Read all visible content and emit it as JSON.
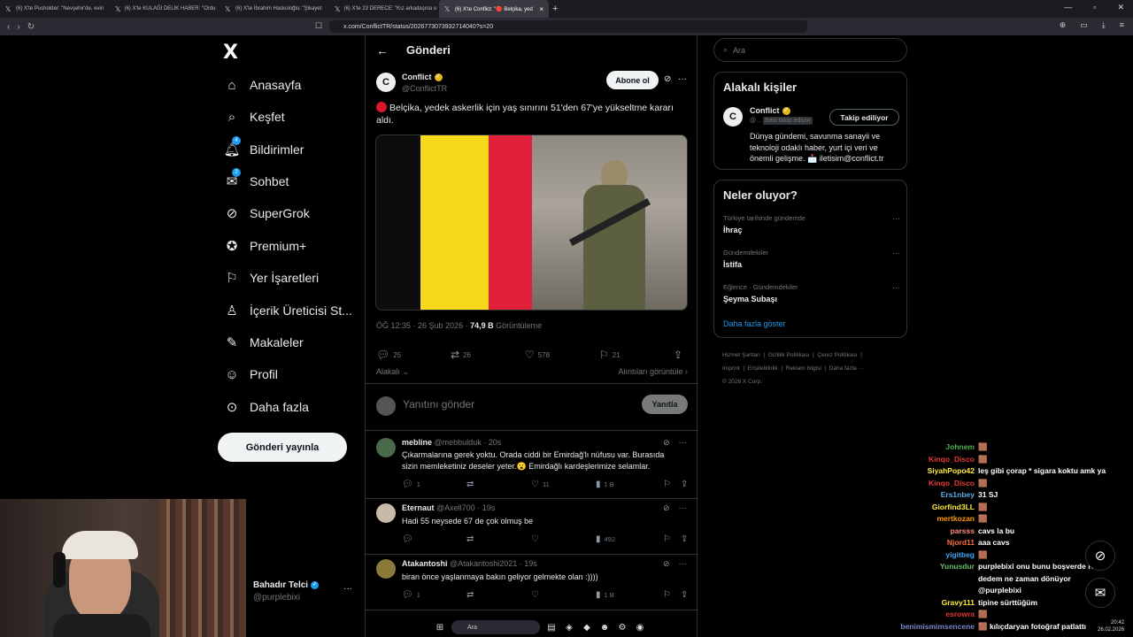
{
  "browser": {
    "tabs": [
      {
        "label": "(6) X'te Pusholder: \"Nevşehir'de, evin",
        "active": false
      },
      {
        "label": "(6) X'te KULAĞI DELİK HABER: \"Ordu",
        "active": false
      },
      {
        "label": "(6) X'te İbrahim Haskoloğlu: \"Şikayet",
        "active": false
      },
      {
        "label": "(6) X'te 23 DERECE: \"Kız arkadaşına o",
        "active": false
      },
      {
        "label": "(6) X'te Conflict: \"🔴 Belçika, yed",
        "active": true
      }
    ],
    "new_tab": "+",
    "url": "x.com/ConflictTR/status/2026773073932714040?s=20"
  },
  "sidebar": {
    "logo": "X",
    "items": [
      {
        "label": "Anasayfa",
        "icon": "home-icon"
      },
      {
        "label": "Keşfet",
        "icon": "search-icon"
      },
      {
        "label": "Bildirimler",
        "icon": "bell-icon",
        "badge": "4"
      },
      {
        "label": "Sohbet",
        "icon": "mail-icon",
        "badge": "2"
      },
      {
        "label": "SuperGrok",
        "icon": "grok-icon"
      },
      {
        "label": "Premium+",
        "icon": "verified-icon"
      },
      {
        "label": "Yer İşaretleri",
        "icon": "bookmark-icon"
      },
      {
        "label": "İçerik Üreticisi St...",
        "icon": "creator-icon"
      },
      {
        "label": "Makaleler",
        "icon": "article-icon"
      },
      {
        "label": "Profil",
        "icon": "person-icon"
      },
      {
        "label": "Daha fazla",
        "icon": "more-circle-icon"
      }
    ],
    "post_button": "Gönderi yayınla",
    "profile": {
      "name": "Bahadır Telci",
      "handle": "@purplebixi",
      "more": "···"
    }
  },
  "main": {
    "title": "Gönderi",
    "post": {
      "author": "Conflict",
      "handle": "@ConflictTR",
      "avatar_letter": "C",
      "subscribe": "Abone ol",
      "text": "Belçika, yedek askerlik için yaş sınırını 51'den 67'ye yükseltme kararı aldı.",
      "time": "ÖĞ 12:35 · 26 Şub 2026 · ",
      "views": "74,9 B",
      "views_label": " Görüntüleme",
      "replies": "25",
      "reposts": "26",
      "likes": "578",
      "bookmarks": "21",
      "sort": "Alakalı",
      "quotes": "Alıntıları görüntüle"
    },
    "reply_box": {
      "placeholder": "Yanıtını gönder",
      "button": "Yanıtla"
    },
    "replies": [
      {
        "name": "mebline",
        "meta": "@mebbulduk · 20s",
        "text": "Çıkarmalarına gerek yoktu. Orada ciddi bir Emirdağ'lı nüfusu var. Burasıda sizin memleketiniz deseler yeter.😮 Emirdağlı kardeşlerimize selamlar.",
        "replies": "1",
        "reposts": "",
        "likes": "11",
        "views": "1 B"
      },
      {
        "name": "Eternaut",
        "meta": "@Axell700 · 19s",
        "text": "Hadi 55 neysede 67 de çok olmuş be",
        "replies": "",
        "reposts": "",
        "likes": "",
        "views": "492"
      },
      {
        "name": "Atakantoshi",
        "meta": "@Atakantoshi2021 · 19s",
        "text": "biran önce yaşlanmaya bakın geliyor gelmekte olan :))))",
        "replies": "1",
        "reposts": "",
        "likes": "",
        "views": "1 B"
      }
    ]
  },
  "right": {
    "search_placeholder": "Ara",
    "relevant": {
      "title": "Alakalı kişiler",
      "name": "Conflict",
      "handle": "@...",
      "follows_you": "Seni takip ediyor",
      "button": "Takip ediliyor",
      "bio": "Dünya gündemi, savunma sanayii ve teknoloji odaklı haber, yurt içi veri ve önemli gelişme. 📩 iletisim@conflict.tr"
    },
    "trends": {
      "title": "Neler oluyor?",
      "items": [
        {
          "context": "Türkiye tarihinde gündemde",
          "name": "İhraç"
        },
        {
          "context": "Gündemdekiler",
          "name": "İstifa"
        },
        {
          "context": "Eğlence · Gündemdekiler",
          "name": "Şeyma Subaşı"
        }
      ],
      "show_more": "Daha fazla göster"
    },
    "footer": [
      "Hizmet Şartları",
      "Gizlilik Politikası",
      "Çerez Politikası",
      "Imprint",
      "Erişilebilirlik",
      "Reklam bilgisi",
      "Daha fazla ···",
      "© 2026 X Corp."
    ]
  },
  "chat": [
    {
      "user": "Johnem",
      "msg": "🟫",
      "color": "#4caf50"
    },
    {
      "user": "Kinqo_Disco",
      "msg": "🟫",
      "color": "#e53935"
    },
    {
      "user": "SiyahPopo42",
      "msg": "leş gibi çorap * sigara koktu amk ya",
      "color": "#ffeb3b"
    },
    {
      "user": "Kinqo_Disco",
      "msg": "🟫",
      "color": "#e53935"
    },
    {
      "user": "Ers1nbey",
      "msg": "31 SJ",
      "color": "#5dade2"
    },
    {
      "user": "Giorfind3LL",
      "msg": "🟫",
      "color": "#ffeb3b"
    },
    {
      "user": "mertkozan",
      "msg": "🟫",
      "color": "#ff9800"
    },
    {
      "user": "parsss",
      "msg": "cavs la bu",
      "color": "#ff8a80"
    },
    {
      "user": "Njord11",
      "msg": "aaa cavs",
      "color": "#ff7043"
    },
    {
      "user": "yigitbeg",
      "msg": "🟫",
      "color": "#42a5f5"
    },
    {
      "user": "Yunusdur",
      "msg": "purplebixi onu bunu boşverde KK",
      "color": "#66bb6a"
    },
    {
      "user": "",
      "msg": "dedem ne zaman dönüyor",
      "color": "#ffffff"
    },
    {
      "user": "",
      "msg": "@purplebixi",
      "color": "#ffffff"
    },
    {
      "user": "Gravy111",
      "msg": "tipine sürttüğüm",
      "color": "#ffeb3b"
    },
    {
      "user": "esrowra",
      "msg": "🟫",
      "color": "#e53935"
    },
    {
      "user": "benimismimsencene",
      "msg": "🟫 kılıçdaryan fotoğraf patlattı",
      "color": "#7986cb"
    }
  ],
  "taskbar": {
    "search": "Ara",
    "time": "20:42",
    "date": "26.02.2026"
  },
  "colors": {
    "accent": "#1d9bf0",
    "background": "#000000",
    "border": "#2f3336",
    "muted": "#71767b"
  }
}
